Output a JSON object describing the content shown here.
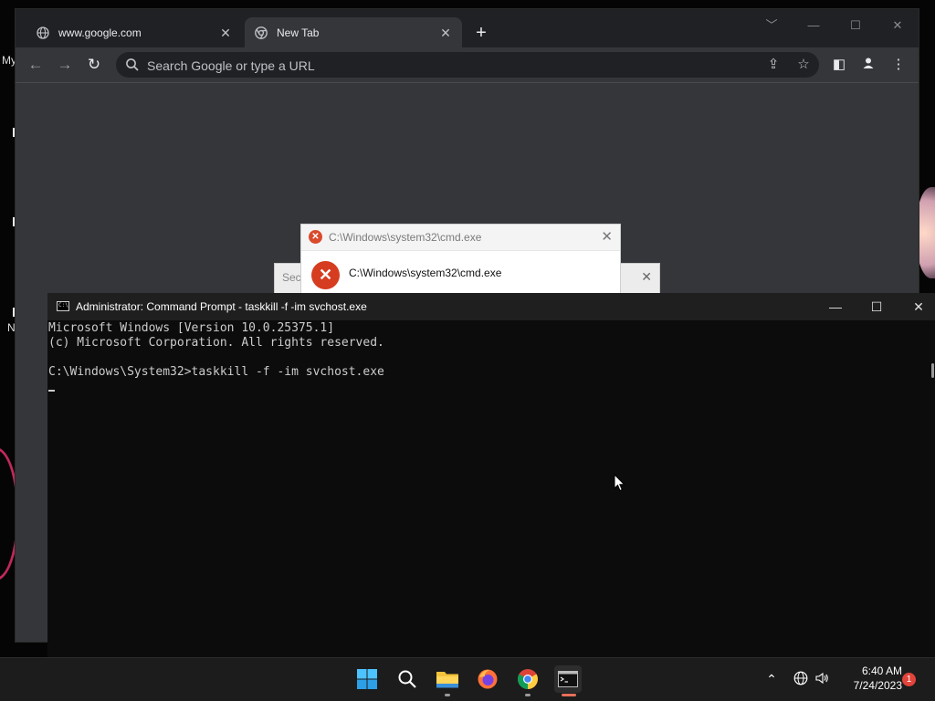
{
  "desktop": {
    "labels": [
      "My",
      "N"
    ]
  },
  "browser": {
    "tabs": [
      {
        "title": "www.google.com",
        "state": "inactive",
        "icon": "globe-icon"
      },
      {
        "title": "New Tab",
        "state": "active",
        "icon": "chrome-icon"
      }
    ],
    "omnibox_placeholder": "Search Google or type a URL",
    "colors": {
      "frame": "#202124",
      "content": "#35363a",
      "omnibox": "#202124"
    }
  },
  "dialogs": {
    "back_title_fragment": "Sec",
    "front_title": "C:\\Windows\\system32\\cmd.exe",
    "front_message": "C:\\Windows\\system32\\cmd.exe",
    "error_color": "#d63c1f"
  },
  "cmd": {
    "title": "Administrator:  Command Prompt - taskkill  -f -im svchost.exe",
    "lines": [
      "Microsoft Windows [Version 10.0.25375.1]",
      "(c) Microsoft Corporation. All rights reserved.",
      "",
      "C:\\Windows\\System32>taskkill -f -im svchost.exe"
    ]
  },
  "taskbar": {
    "apps": [
      {
        "name": "start",
        "icon": "windows-logo-icon"
      },
      {
        "name": "search",
        "icon": "search-icon"
      },
      {
        "name": "file-explorer",
        "icon": "folder-icon",
        "running": true
      },
      {
        "name": "firefox",
        "icon": "firefox-icon"
      },
      {
        "name": "chrome",
        "icon": "chrome-icon",
        "running": true
      },
      {
        "name": "terminal",
        "icon": "terminal-icon",
        "running": true,
        "active": true
      }
    ],
    "clock": {
      "time": "6:40 AM",
      "date": "7/24/2023"
    },
    "notification_count": "1"
  }
}
